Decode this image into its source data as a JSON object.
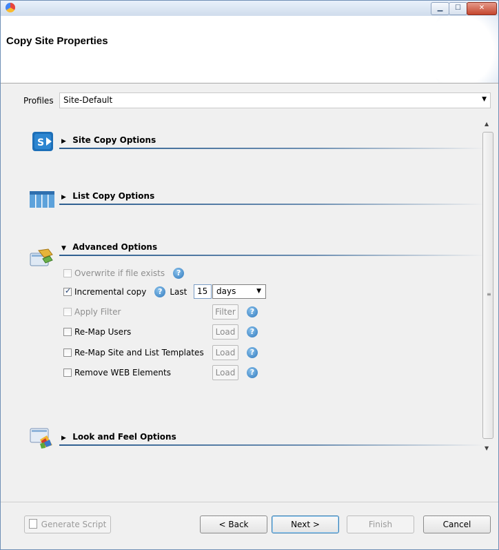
{
  "window": {
    "minimize_glyph": "▁",
    "maximize_glyph": "☐",
    "close_glyph": "✕"
  },
  "header": {
    "title": "Copy Site Properties"
  },
  "profiles": {
    "label": "Profiles",
    "value": "Site-Default",
    "arrow": "▼"
  },
  "sections": {
    "site_copy": {
      "label": "Site Copy Options",
      "expanded": false,
      "icon": "sharepoint-icon"
    },
    "list_copy": {
      "label": "List Copy Options",
      "expanded": false,
      "icon": "list-icon"
    },
    "advanced": {
      "label": "Advanced Options",
      "expanded": true,
      "icon": "advanced-options-icon"
    },
    "look_feel": {
      "label": "Look and Feel Options",
      "expanded": false,
      "icon": "look-and-feel-icon"
    }
  },
  "triangles": {
    "collapsed": "▶",
    "expanded": "▼"
  },
  "advanced_options": {
    "overwrite": {
      "label": "Overwrite if file exists",
      "checked": false,
      "enabled": false
    },
    "incremental": {
      "label": "Incremental copy",
      "checked": true,
      "enabled": true,
      "last_label": "Last",
      "count": "15",
      "unit": "days"
    },
    "apply_filter": {
      "label": "Apply Filter",
      "checked": false,
      "enabled": false,
      "button": "Filter"
    },
    "remap_users": {
      "label": "Re-Map Users",
      "checked": false,
      "enabled": true,
      "button": "Load"
    },
    "remap_templates": {
      "label": "Re-Map Site and List Templates",
      "checked": false,
      "enabled": true,
      "button": "Load"
    },
    "remove_web": {
      "label": "Remove WEB Elements",
      "checked": false,
      "enabled": true,
      "button": "Load"
    }
  },
  "help_glyph": "?",
  "scrollbar": {
    "up": "▲",
    "down": "▼",
    "grip": "≡"
  },
  "footer": {
    "generate_script": "Generate Script",
    "back": "< Back",
    "next": "Next >",
    "finish": "Finish",
    "cancel": "Cancel"
  }
}
